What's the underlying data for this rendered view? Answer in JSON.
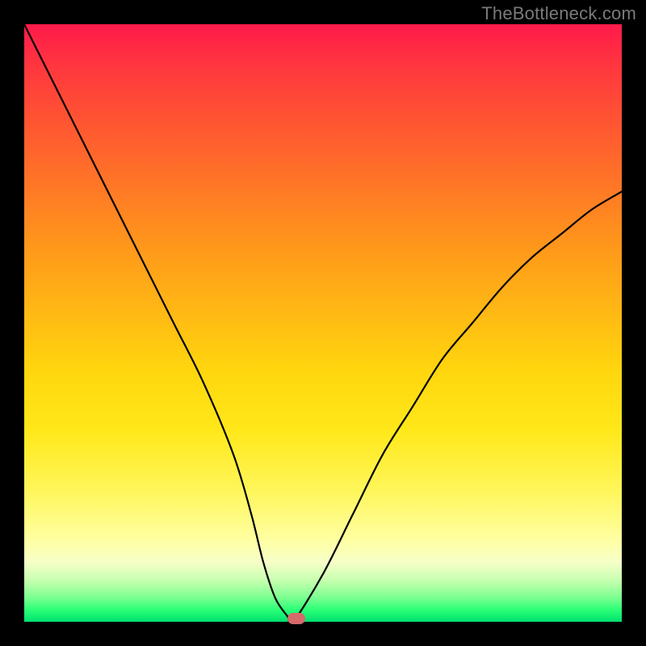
{
  "watermark": "TheBottleneck.com",
  "chart_data": {
    "type": "line",
    "title": "",
    "xlabel": "",
    "ylabel": "",
    "xlim": [
      0,
      100
    ],
    "ylim": [
      0,
      100
    ],
    "grid": false,
    "legend": false,
    "background": "rainbow_gradient_vertical",
    "series": [
      {
        "name": "bottleneck-curve",
        "x": [
          0,
          5,
          10,
          15,
          20,
          25,
          30,
          35,
          38,
          40,
          42,
          44,
          45,
          50,
          55,
          60,
          65,
          70,
          75,
          80,
          85,
          90,
          95,
          100
        ],
        "values": [
          100,
          90,
          80,
          70,
          60,
          50,
          40,
          28,
          18,
          10,
          4,
          1,
          0,
          8,
          18,
          28,
          36,
          44,
          50,
          56,
          61,
          65,
          69,
          72
        ]
      }
    ],
    "marker": {
      "x": 45.5,
      "y": 0.5,
      "shape": "pill",
      "color": "#d46a6a"
    }
  }
}
